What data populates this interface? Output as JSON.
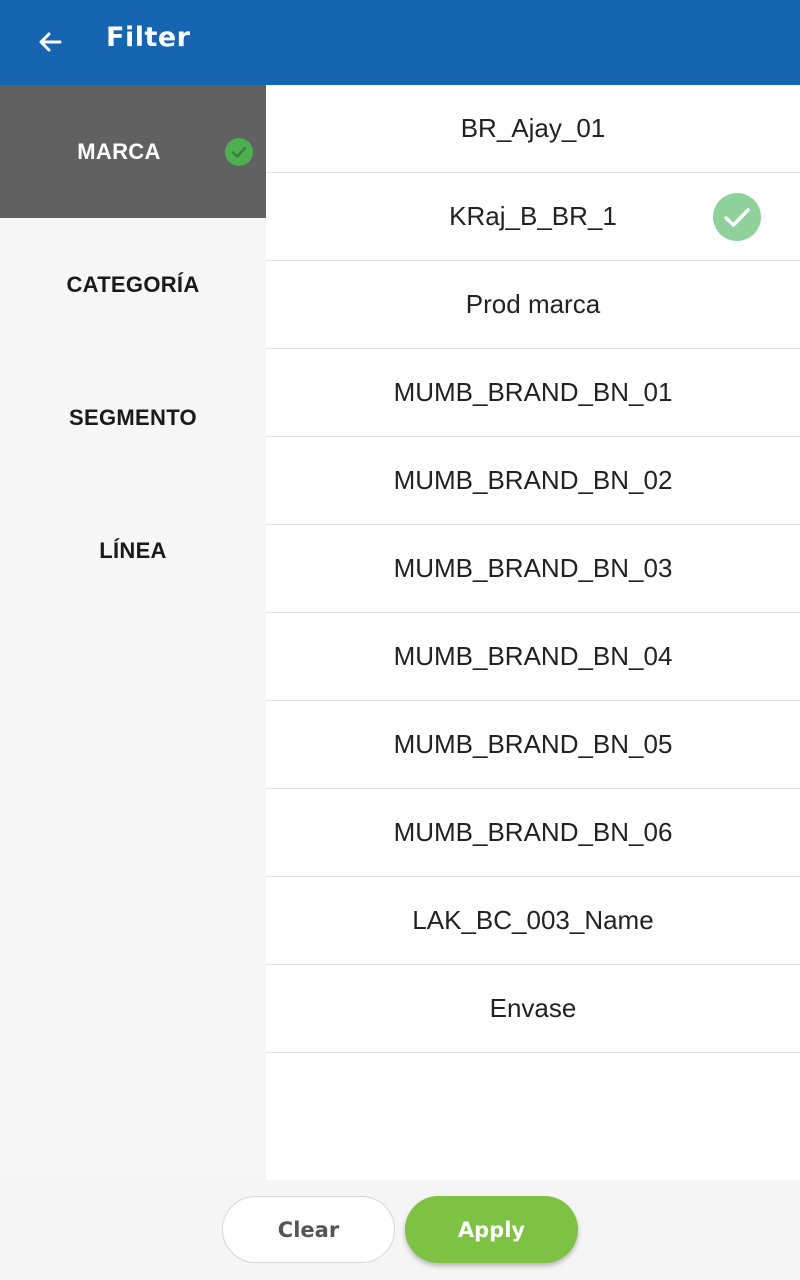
{
  "header": {
    "title": "Filter",
    "back_icon": "arrow-left-icon"
  },
  "colors": {
    "header_bg": "#1565b0",
    "active_tab_bg": "#616161",
    "check_green": "#4caf50",
    "apply_green": "#7dc242"
  },
  "sidebar": {
    "items": [
      {
        "label": "MARCA",
        "active": true,
        "has_selection": true
      },
      {
        "label": "CATEGORÍA",
        "active": false,
        "has_selection": false
      },
      {
        "label": "SEGMENTO",
        "active": false,
        "has_selection": false
      },
      {
        "label": "LÍNEA",
        "active": false,
        "has_selection": false
      }
    ]
  },
  "options": [
    {
      "label": "BR_Ajay_01",
      "selected": false
    },
    {
      "label": "KRaj_B_BR_1",
      "selected": true
    },
    {
      "label": "Prod marca",
      "selected": false
    },
    {
      "label": "MUMB_BRAND_BN_01",
      "selected": false
    },
    {
      "label": "MUMB_BRAND_BN_02",
      "selected": false
    },
    {
      "label": "MUMB_BRAND_BN_03",
      "selected": false
    },
    {
      "label": "MUMB_BRAND_BN_04",
      "selected": false
    },
    {
      "label": "MUMB_BRAND_BN_05",
      "selected": false
    },
    {
      "label": "MUMB_BRAND_BN_06",
      "selected": false
    },
    {
      "label": "LAK_BC_003_Name",
      "selected": false
    },
    {
      "label": "Envase",
      "selected": false
    }
  ],
  "footer": {
    "clear_label": "Clear",
    "apply_label": "Apply"
  }
}
